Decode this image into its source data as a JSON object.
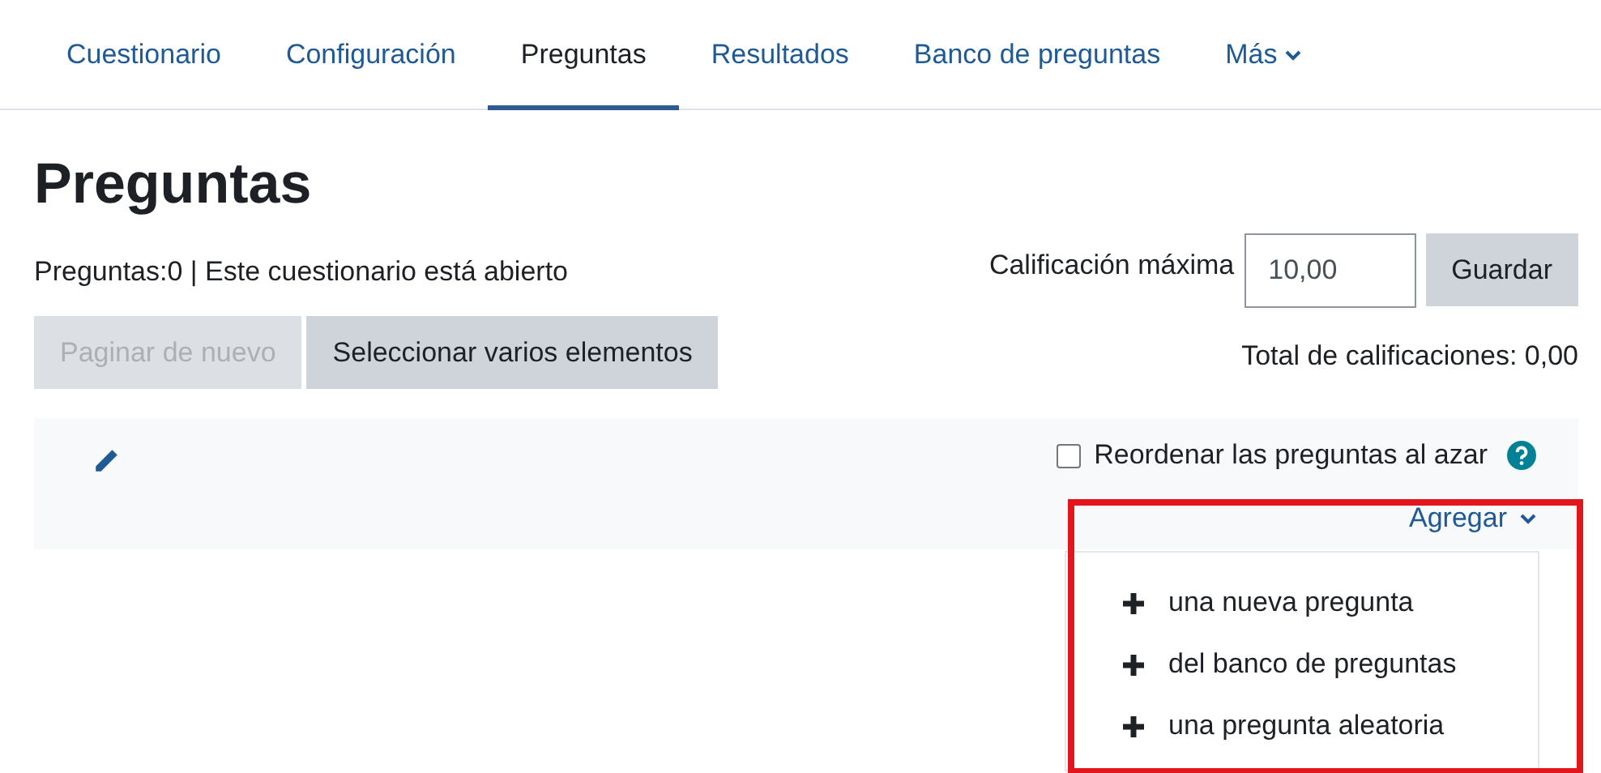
{
  "tabs": [
    {
      "label": "Cuestionario",
      "selected": false
    },
    {
      "label": "Configuración",
      "selected": false
    },
    {
      "label": "Preguntas",
      "selected": true
    },
    {
      "label": "Resultados",
      "selected": false
    },
    {
      "label": "Banco de preguntas",
      "selected": false
    },
    {
      "label": "Más",
      "selected": false,
      "kind": "dropdown"
    }
  ],
  "heading": "Preguntas",
  "status": "Preguntas:0 | Este cuestionario está abierto",
  "max_grade": {
    "label": "Calificación máxima",
    "value": "10,00",
    "button": "Guardar"
  },
  "buttons": [
    {
      "label": "Paginar de nuevo",
      "disabled": true
    },
    {
      "label": "Seleccionar varios elementos",
      "disabled": false
    }
  ],
  "total": "Total de calificaciones: 0,00",
  "shuffle": {
    "label": "Reordenar las preguntas al azar",
    "checked": false
  },
  "add_menu": {
    "label": "Agregar",
    "expanded": true,
    "items": [
      "una nueva pregunta",
      "del banco de preguntas",
      "una pregunta aleatoria"
    ]
  }
}
